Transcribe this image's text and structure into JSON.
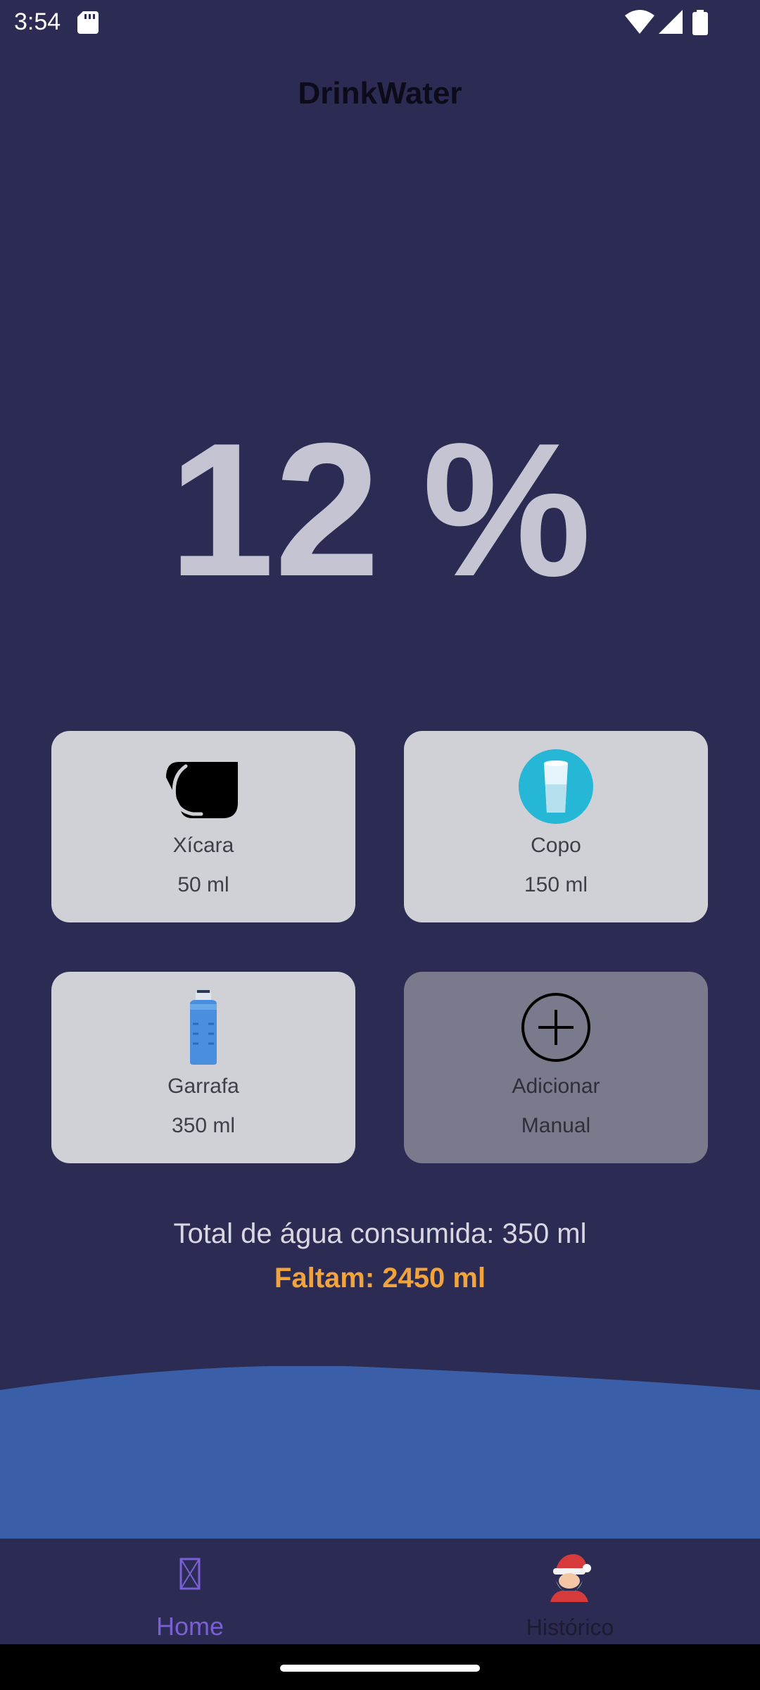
{
  "status_bar": {
    "time": "3:54",
    "icons": [
      "sd-card-icon",
      "wifi-icon",
      "signal-icon",
      "battery-icon"
    ]
  },
  "app": {
    "title": "DrinkWater"
  },
  "progress": {
    "value": "12",
    "unit": "%",
    "percent": 12
  },
  "options": [
    {
      "name": "Xícara",
      "volume": "50 ml",
      "icon": "mug-icon"
    },
    {
      "name": "Copo",
      "volume": "150 ml",
      "icon": "glass-icon"
    },
    {
      "name": "Garrafa",
      "volume": "350 ml",
      "icon": "bottle-icon"
    },
    {
      "name": "Adicionar",
      "volume": "Manual",
      "icon": "add-circle-icon"
    }
  ],
  "summary": {
    "total": "Total de água consumida: 350 ml",
    "remaining": "Faltam: 2450 ml"
  },
  "nav": {
    "items": [
      {
        "label": "Home",
        "icon": "home-icon",
        "active": true
      },
      {
        "label": "Histórico",
        "icon": "santa-icon",
        "active": false
      }
    ]
  },
  "colors": {
    "background": "#2b2b53",
    "card": "#d0d0d7",
    "card_manual": "#797a8b",
    "wave": "#3a5fa8",
    "remaining": "#f2a33c",
    "nav_active": "#7b5fd6"
  }
}
